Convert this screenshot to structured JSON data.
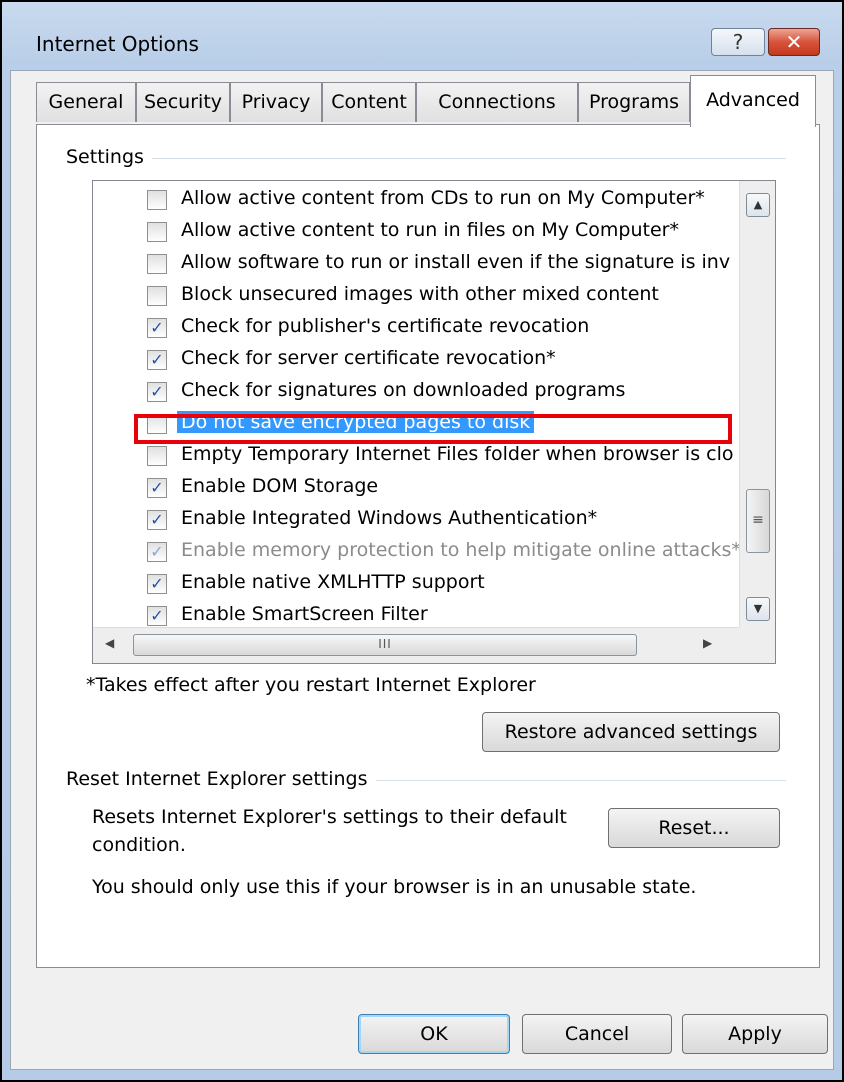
{
  "window": {
    "title": "Internet Options",
    "help_glyph": "?",
    "close_glyph": "✕"
  },
  "tabs": [
    {
      "label": "General"
    },
    {
      "label": "Security"
    },
    {
      "label": "Privacy"
    },
    {
      "label": "Content"
    },
    {
      "label": "Connections"
    },
    {
      "label": "Programs"
    },
    {
      "label": "Advanced"
    }
  ],
  "settings": {
    "group_label": "Settings",
    "items": [
      {
        "label": "Allow active content from CDs to run on My Computer*",
        "checked": false
      },
      {
        "label": "Allow active content to run in files on My Computer*",
        "checked": false
      },
      {
        "label": "Allow software to run or install even if the signature is inv",
        "checked": false
      },
      {
        "label": "Block unsecured images with other mixed content",
        "checked": false
      },
      {
        "label": "Check for publisher's certificate revocation",
        "checked": true
      },
      {
        "label": "Check for server certificate revocation*",
        "checked": true
      },
      {
        "label": "Check for signatures on downloaded programs",
        "checked": true
      },
      {
        "label": "Do not save encrypted pages to disk",
        "checked": false,
        "selected": true
      },
      {
        "label": "Empty Temporary Internet Files folder when browser is clo",
        "checked": false
      },
      {
        "label": "Enable DOM Storage",
        "checked": true
      },
      {
        "label": "Enable Integrated Windows Authentication*",
        "checked": true
      },
      {
        "label": "Enable memory protection to help mitigate online attacks*",
        "checked": true,
        "disabled": true
      },
      {
        "label": "Enable native XMLHTTP support",
        "checked": true
      },
      {
        "label": "Enable SmartScreen Filter",
        "checked": true
      }
    ],
    "scroll_thumb_glyph": "≡",
    "hscroll_thumb_glyph": "III",
    "note": "*Takes effect after you restart Internet Explorer",
    "restore_button": "Restore advanced settings"
  },
  "reset": {
    "group_label": "Reset Internet Explorer settings",
    "description_line1": "Resets Internet Explorer's settings to their default",
    "description_line2": "condition.",
    "button": "Reset...",
    "warning": "You should only use this if your browser is in an unusable state."
  },
  "footer": {
    "ok": "OK",
    "cancel": "Cancel",
    "apply": "Apply"
  },
  "colors": {
    "selection": "#3399ff",
    "highlight_box": "#e8000a",
    "check": "#2a4fb0"
  }
}
